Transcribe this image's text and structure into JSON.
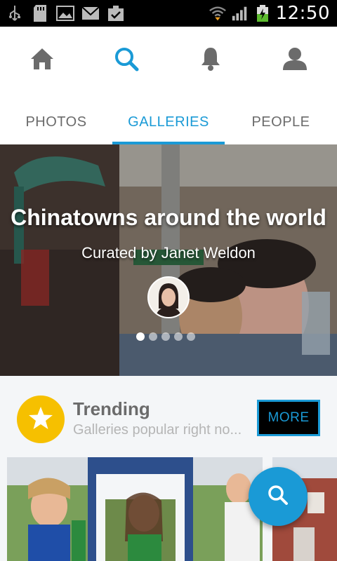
{
  "status_bar": {
    "time": "12:50",
    "left_icons": [
      "usb-icon",
      "sd-card-icon",
      "image-icon",
      "mail-icon",
      "clipboard-check-icon"
    ],
    "right_icons": [
      "wifi-icon",
      "signal-icon",
      "battery-charging-icon"
    ]
  },
  "nav": {
    "items": [
      {
        "icon": "home-icon",
        "active": false
      },
      {
        "icon": "search-icon",
        "active": true
      },
      {
        "icon": "bell-icon",
        "active": false
      },
      {
        "icon": "profile-icon",
        "active": false
      }
    ]
  },
  "tabs": [
    {
      "label": "PHOTOS",
      "active": false
    },
    {
      "label": "GALLERIES",
      "active": true
    },
    {
      "label": "PEOPLE",
      "active": false
    }
  ],
  "hero": {
    "title": "Chinatowns around the world",
    "subtitle": "Curated by Janet Weldon",
    "slide_count": 5,
    "active_slide": 1
  },
  "trending": {
    "title": "Trending",
    "subtitle": "Galleries popular right no...",
    "more_label": "MORE"
  },
  "colors": {
    "accent": "#1a9ad6",
    "badge": "#f6c000",
    "inactive_icon": "#6b6b6b"
  }
}
